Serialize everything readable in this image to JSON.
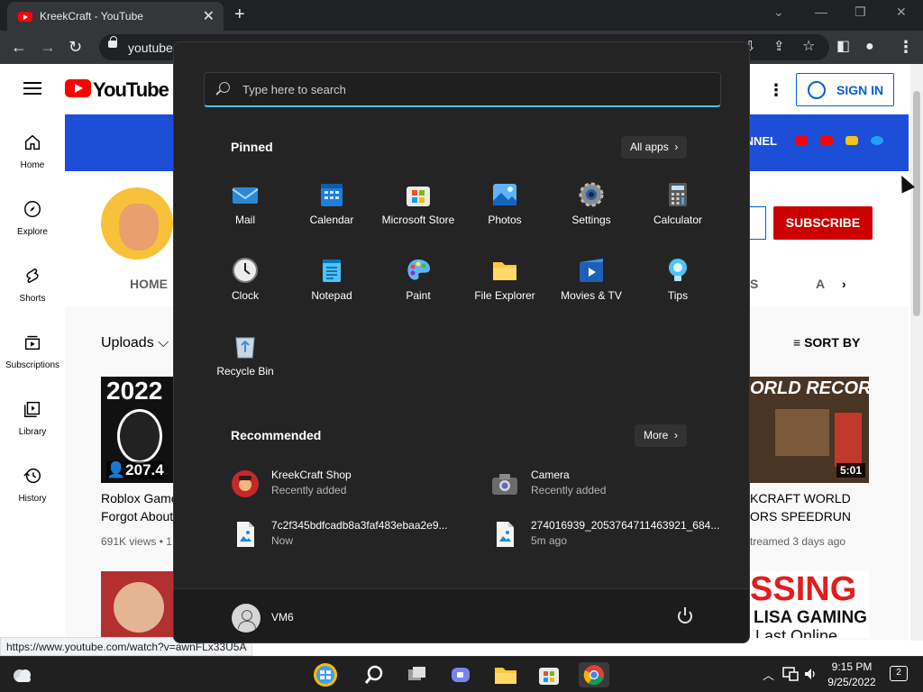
{
  "browser": {
    "tab_title": "KreekCraft - YouTube",
    "tab_close": "✕",
    "new_tab": "+",
    "url": "youtube",
    "status_url": "https://www.youtube.com/watch?v=awnFLx33U5A"
  },
  "youtube": {
    "logo_text": "YouTube",
    "sign_in": "SIGN IN",
    "subscribe": "SUBSCRIBE",
    "banner_text": "NNEL",
    "tab_home": "HOME",
    "tab_frag_s": "S",
    "tab_frag_a": "A",
    "uploads": "Uploads",
    "sort_by": "SORT BY",
    "sidebar": [
      {
        "label": "Home"
      },
      {
        "label": "Explore"
      },
      {
        "label": "Shorts"
      },
      {
        "label": "Subscriptions"
      },
      {
        "label": "Library"
      },
      {
        "label": "History"
      }
    ],
    "videos": [
      {
        "thumb_text": "2022",
        "views_badge": "207.4",
        "title_line1": "Roblox Game",
        "title_line2": "Forgot About",
        "meta": "691K views • 1"
      },
      {
        "thumb_text": "ORLD RECORD",
        "duration": "5:01",
        "title_line1": "KCRAFT WORLD",
        "title_line2": "ORS SPEEDRUN",
        "meta": "treamed 3 days ago"
      },
      {
        "thumb_text": "SSING",
        "thumb_text2": "LISA GAMING",
        "thumb_text3": "Last Online"
      }
    ]
  },
  "start_menu": {
    "search_placeholder": "Type here to search",
    "pinned_title": "Pinned",
    "all_apps": "All apps",
    "pinned": [
      {
        "name": "Mail",
        "icon": "mail-icon"
      },
      {
        "name": "Calendar",
        "icon": "calendar-icon"
      },
      {
        "name": "Microsoft Store",
        "icon": "store-icon"
      },
      {
        "name": "Photos",
        "icon": "photos-icon"
      },
      {
        "name": "Settings",
        "icon": "settings-icon"
      },
      {
        "name": "Calculator",
        "icon": "calculator-icon"
      },
      {
        "name": "Clock",
        "icon": "clock-icon"
      },
      {
        "name": "Notepad",
        "icon": "notepad-icon"
      },
      {
        "name": "Paint",
        "icon": "paint-icon"
      },
      {
        "name": "File Explorer",
        "icon": "folder-icon"
      },
      {
        "name": "Movies & TV",
        "icon": "movies-icon"
      },
      {
        "name": "Tips",
        "icon": "tips-icon"
      },
      {
        "name": "Recycle Bin",
        "icon": "recycle-bin-icon"
      }
    ],
    "recommended_title": "Recommended",
    "more": "More",
    "recommended": [
      {
        "title": "KreekCraft Shop",
        "subtitle": "Recently added"
      },
      {
        "title": "Camera",
        "subtitle": "Recently added"
      },
      {
        "title": "7c2f345bdfcadb8a3faf483ebaa2e9...",
        "subtitle": "Now"
      },
      {
        "title": "274016939_2053764711463921_684...",
        "subtitle": "5m ago"
      }
    ],
    "user_name": "VM6"
  },
  "taskbar": {
    "time": "9:15 PM",
    "date": "9/25/2022",
    "notifications": "2"
  },
  "colors": {
    "accent": "#4cc2ff",
    "youtube_red": "#ff0000",
    "subscribe_red": "#cc0000",
    "signin_blue": "#065fd4",
    "start_bg": "#242424"
  }
}
